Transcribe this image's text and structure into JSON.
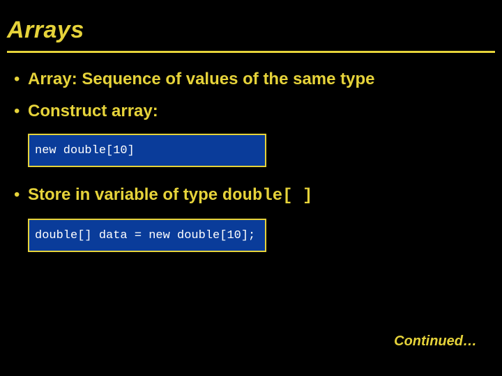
{
  "title": "Arrays",
  "bullets": {
    "b1": "Array: Sequence of values of the same type",
    "b2": "Construct array:",
    "b3_prefix": "Store in variable of type ",
    "b3_code": "double[ ]"
  },
  "code_blocks": {
    "c1": "new double[10]",
    "c2": "double[] data = new double[10];"
  },
  "continued_label": "Continued…"
}
